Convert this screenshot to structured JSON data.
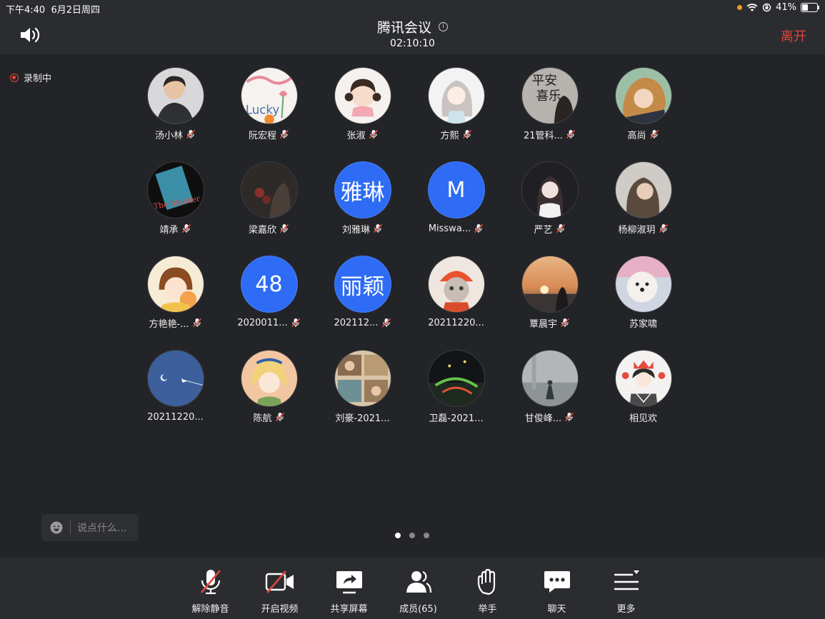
{
  "status": {
    "time": "下午4:40",
    "date": "6月2日周四",
    "battery": "41%",
    "battery_level": 0.41
  },
  "header": {
    "title": "腾讯会议",
    "timer": "02:10:10",
    "leave": "离开"
  },
  "recording": {
    "label": "录制中"
  },
  "participants": [
    {
      "name": "汤小林",
      "muted": true,
      "avatar": "photo-man"
    },
    {
      "name": "阮宏程",
      "muted": true,
      "avatar": "lucky-drawing"
    },
    {
      "name": "张淑",
      "muted": true,
      "avatar": "cartoon-girl"
    },
    {
      "name": "方熙",
      "muted": true,
      "avatar": "anime-girl"
    },
    {
      "name": "21管科...",
      "muted": true,
      "avatar": "calligraphy"
    },
    {
      "name": "高尚",
      "muted": true,
      "avatar": "anime-boy"
    },
    {
      "name": "靖承",
      "muted": true,
      "avatar": "book-cover"
    },
    {
      "name": "梁嘉欣",
      "muted": true,
      "avatar": "dark-flowers"
    },
    {
      "name": "刘雅琳",
      "muted": true,
      "avatar_text": "雅琳"
    },
    {
      "name": "Misswa...",
      "muted": true,
      "avatar_text": "M"
    },
    {
      "name": "严艺",
      "muted": true,
      "avatar": "photo-woman"
    },
    {
      "name": "杨柳淑玥",
      "muted": true,
      "avatar": "photo-girl"
    },
    {
      "name": "方艳艳-...",
      "muted": true,
      "avatar": "cartoon-girl-orange"
    },
    {
      "name": "2020011...",
      "muted": true,
      "avatar_text": "48"
    },
    {
      "name": "202112...",
      "muted": true,
      "avatar_text": "丽颖"
    },
    {
      "name": "20211220...",
      "muted": false,
      "avatar": "cat-costume"
    },
    {
      "name": "覃晨宇",
      "muted": true,
      "avatar": "sunset-silhouette"
    },
    {
      "name": "苏家啸",
      "muted": false,
      "avatar": "white-dog"
    },
    {
      "name": "20211220...",
      "muted": false,
      "avatar": "blue-sky-plane"
    },
    {
      "name": "陈航",
      "muted": true,
      "avatar": "cartoon-girl-blonde"
    },
    {
      "name": "刘豪-2021...",
      "muted": false,
      "avatar": "collage"
    },
    {
      "name": "卫磊-2021...",
      "muted": false,
      "avatar": "night-scene"
    },
    {
      "name": "甘俊峰...",
      "muted": true,
      "avatar": "misty-figure"
    },
    {
      "name": "相见欢",
      "muted": false,
      "avatar": "anime-boy-crown"
    }
  ],
  "chat": {
    "placeholder": "说点什么..."
  },
  "pagination": {
    "pages": 3,
    "current": 1
  },
  "toolbar": [
    {
      "label": "解除静音",
      "icon": "mic-off-icon"
    },
    {
      "label": "开启视频",
      "icon": "camera-off-icon"
    },
    {
      "label": "共享屏幕",
      "icon": "share-screen-icon"
    },
    {
      "label": "成员(65)",
      "icon": "members-icon"
    },
    {
      "label": "举手",
      "icon": "raise-hand-icon"
    },
    {
      "label": "聊天",
      "icon": "chat-icon"
    },
    {
      "label": "更多",
      "icon": "more-icon"
    }
  ]
}
